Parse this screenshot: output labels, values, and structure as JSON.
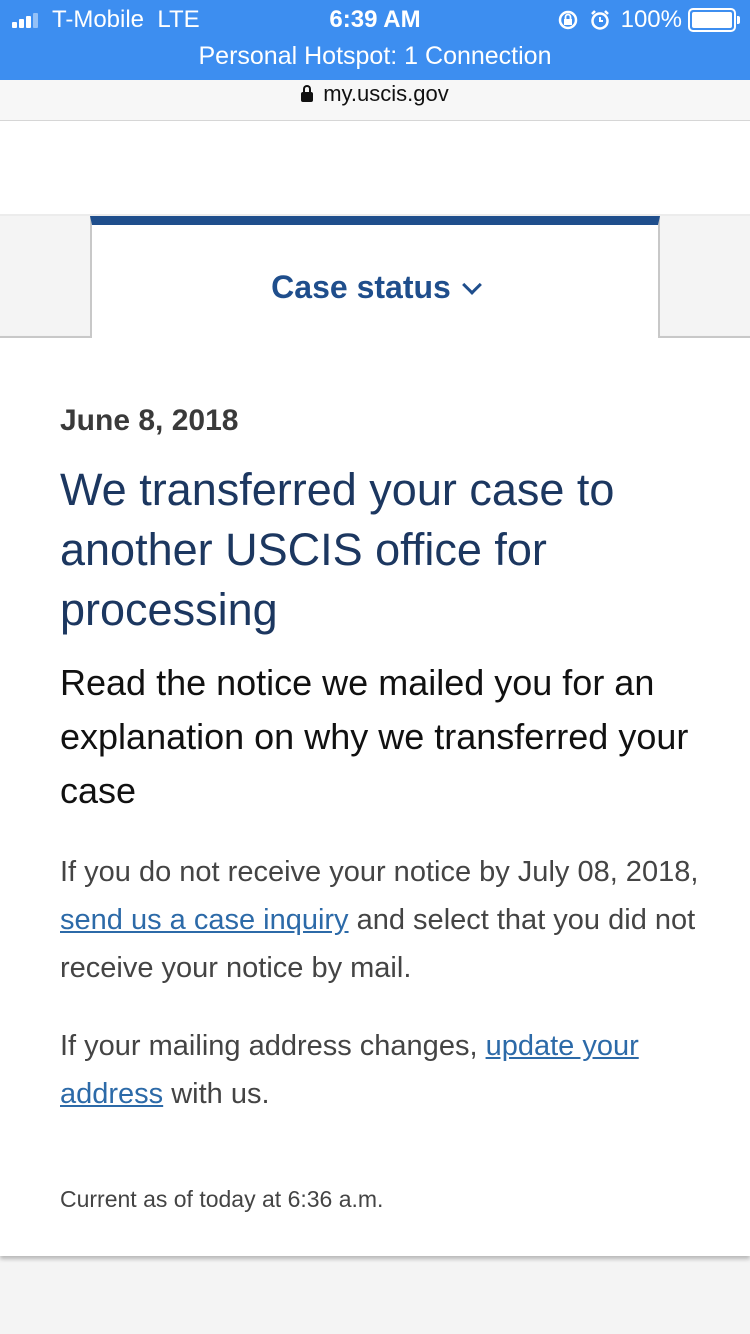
{
  "status_bar": {
    "carrier": "T-Mobile",
    "network": "LTE",
    "time": "6:39 AM",
    "battery": "100%",
    "hotspot": "Personal Hotspot: 1 Connection"
  },
  "browser": {
    "url": "my.uscis.gov"
  },
  "tab": {
    "label": "Case status"
  },
  "case": {
    "date": "June 8, 2018",
    "headline": "We transferred your case to another USCIS office for processing",
    "subheadline": "Read the notice we mailed you for an explanation on why we transferred your case",
    "para1_before": "If you do not receive your notice by July 08, 2018, ",
    "para1_link": "send us a case inquiry",
    "para1_after": " and select that you did not receive your notice by mail.",
    "para2_before": "If your mailing address changes, ",
    "para2_link": "update your address",
    "para2_after": " with us.",
    "updated": "Current as of today at 6:36 a.m."
  },
  "colors": {
    "status_bar": "#3d8ef0",
    "brand_blue": "#1f4e8c",
    "headline": "#1c3760",
    "link": "#2c6aa8"
  }
}
